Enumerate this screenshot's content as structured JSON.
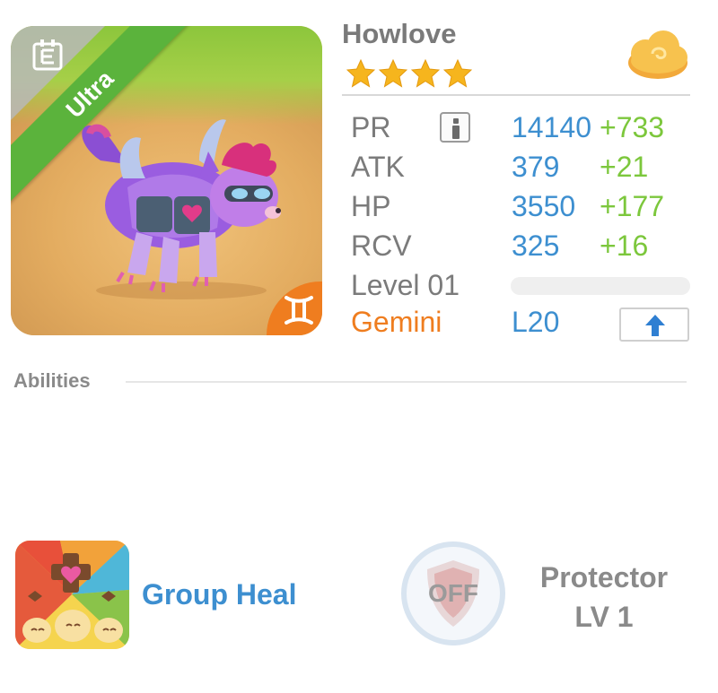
{
  "creature": {
    "name": "Howlove",
    "rarity": "Ultra",
    "star_count": 4,
    "sign": "Gemini",
    "sign_color": "#ef7d1f",
    "max_level_label": "L20"
  },
  "stats": {
    "pr": {
      "label": "PR",
      "value": "14140",
      "bonus": "+733"
    },
    "atk": {
      "label": "ATK",
      "value": "379",
      "bonus": "+21"
    },
    "hp": {
      "label": "HP",
      "value": "3550",
      "bonus": "+177"
    },
    "rcv": {
      "label": "RCV",
      "value": "325",
      "bonus": "+16"
    },
    "level_label": "Level 01",
    "level_progress": 0
  },
  "abilities": {
    "title": "Abilities",
    "active": {
      "name": "Group Heal",
      "icon": "group-heal-icon"
    },
    "passive": {
      "state": "OFF",
      "name": "Protector",
      "level": "LV 1",
      "icon": "protector-shield-icon"
    }
  },
  "colors": {
    "value_blue": "#3d8fd0",
    "bonus_green": "#7cc73c",
    "rarity_green": "#5bb33c",
    "label_gray": "#7b7b7b"
  }
}
